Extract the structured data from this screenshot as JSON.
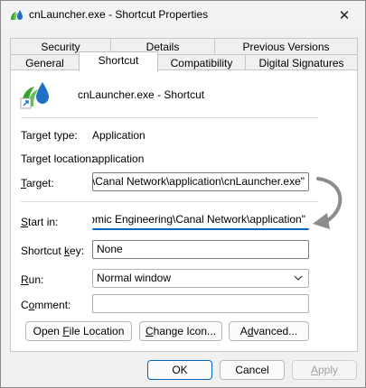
{
  "window": {
    "title": "cnLauncher.exe - Shortcut Properties",
    "close_glyph": "✕"
  },
  "tabs": {
    "row1": [
      "Security",
      "Details",
      "Previous Versions"
    ],
    "row2": [
      "General",
      "Shortcut",
      "Compatibility",
      "Digital Signatures"
    ],
    "active": "Shortcut"
  },
  "header": {
    "app_name": "cnLauncher.exe - Shortcut"
  },
  "fields": {
    "target_type_label": "Target type:",
    "target_type_value": "Application",
    "target_location_label": "Target location:",
    "target_location_value": "application",
    "target_label_prefix": "",
    "target_label_underlined": "T",
    "target_label_rest": "arget:",
    "target_value": "ring\\Canal Network\\application\\cnLauncher.exe\"",
    "start_in_label_prefix": "",
    "start_in_label_underlined": "S",
    "start_in_label_rest": "tart in:",
    "start_in_value": "uanomic Engineering\\Canal Network\\application\"",
    "shortcut_key_label_prefix": "Shortcut ",
    "shortcut_key_label_underlined": "k",
    "shortcut_key_label_rest": "ey:",
    "shortcut_key_value": "None",
    "run_label_prefix": "",
    "run_label_underlined": "R",
    "run_label_rest": "un:",
    "run_value": "Normal window",
    "comment_label_prefix": "C",
    "comment_label_underlined": "o",
    "comment_label_rest": "mment:",
    "comment_value": ""
  },
  "buttons": {
    "open_file_location_prefix": "Open ",
    "open_file_location_underlined": "F",
    "open_file_location_rest": "ile Location",
    "change_icon_prefix": "",
    "change_icon_underlined": "C",
    "change_icon_rest": "hange Icon...",
    "advanced_prefix": "A",
    "advanced_underlined": "d",
    "advanced_rest": "vanced...",
    "ok": "OK",
    "cancel": "Cancel",
    "apply_prefix": "",
    "apply_underlined": "A",
    "apply_rest": "pply"
  },
  "colors": {
    "accent": "#0067c0",
    "arrow": "#8c8c8c"
  }
}
